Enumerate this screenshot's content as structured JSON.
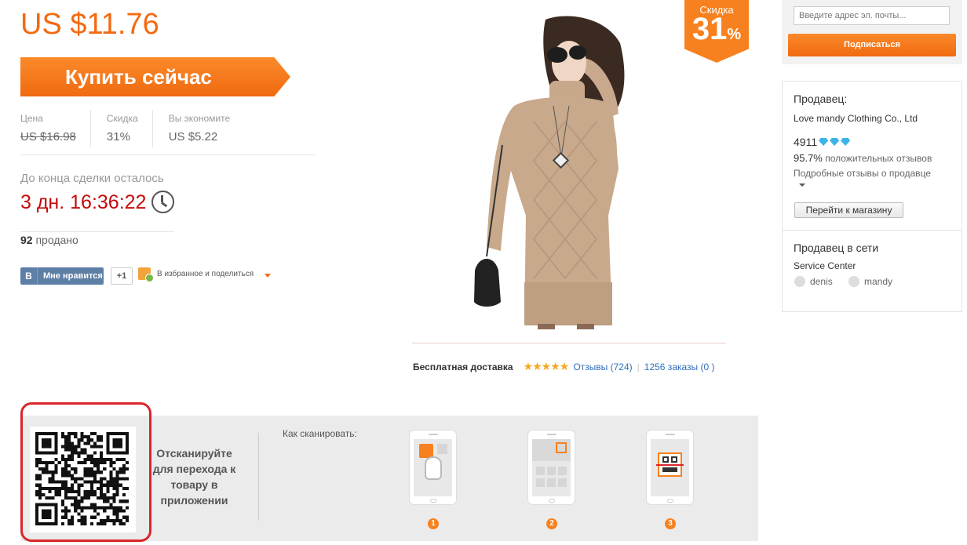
{
  "price": {
    "current": "US $11.76"
  },
  "buy_button": {
    "label": "Купить сейчас"
  },
  "stats": {
    "price_label": "Цена",
    "price_value": "US $16.98",
    "discount_label": "Скидка",
    "discount_value": "31%",
    "save_label": "Вы экономите",
    "save_value": "US $5.22"
  },
  "deal": {
    "label": "До конца сделки осталось",
    "timer": "3 дн. 16:36:22"
  },
  "sold": {
    "count": "92",
    "label": "продано"
  },
  "social": {
    "vk_logo": "B",
    "vk_label": "Мне нравится",
    "plus_one": "+1",
    "share_label": "В избранное и поделиться"
  },
  "badge": {
    "label": "Скидка",
    "number": "31",
    "percent": "%"
  },
  "shipping": {
    "free": "Бесплатная доставка",
    "stars": "★★★★★",
    "reviews": "Отзывы (724)",
    "orders": "1256 заказы (0 )"
  },
  "subscribe": {
    "placeholder": "Введите адрес эл. почты...",
    "button": "Подписаться"
  },
  "seller": {
    "title": "Продавец:",
    "name": "Love mandy Clothing Co., Ltd",
    "score": "4911",
    "positive_pct": "95.7%",
    "positive_label": "положительных отзывов",
    "detail_link": "Подробные отзывы о продавце",
    "store_button": "Перейти к магазину"
  },
  "online": {
    "title": "Продавец в сети",
    "service": "Service Center",
    "agents": [
      "denis",
      "mandy"
    ]
  },
  "qr": {
    "scan_text": "Отсканируйте для перехода к товару в приложении",
    "how_label": "Как сканировать:",
    "steps": [
      "1",
      "2",
      "3"
    ]
  },
  "colors": {
    "accent": "#f36a12",
    "timer": "#c40b0b",
    "link": "#2f6dbd",
    "highlight": "#d9262c"
  }
}
